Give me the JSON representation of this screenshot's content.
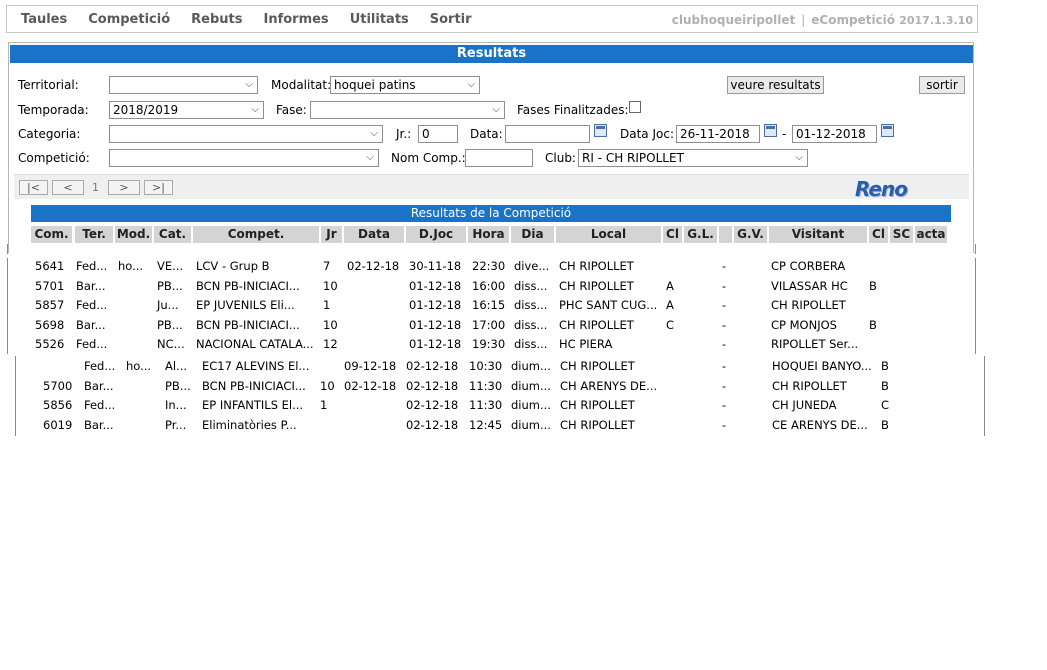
{
  "menu": [
    "Taules",
    "Competició",
    "Rebuts",
    "Informes",
    "Utilitats",
    "Sortir"
  ],
  "brand": {
    "club": "clubhoqueiripollet",
    "sep": "|",
    "app": "eCompetició",
    "version": "2017.1.3.10"
  },
  "panel_title": "Resultats",
  "form": {
    "territorial_label": "Territorial:",
    "territorial_value": "",
    "modalitat_label": "Modalitat:",
    "modalitat_value": "hoquei patins",
    "temporada_label": "Temporada:",
    "temporada_value": "2018/2019",
    "fase_label": "Fase:",
    "fase_value": "",
    "fases_final_label": "Fases Finalitzades:",
    "categoria_label": "Categoria:",
    "categoria_value": "",
    "jr_label": "Jr.:",
    "jr_value": "0",
    "data_label": "Data:",
    "data_value": "",
    "datajoc_label": "Data Joc:",
    "datajoc_from": "26-11-2018",
    "dash": "-",
    "datajoc_to": "01-12-2018",
    "competicio_label": "Competició:",
    "competicio_value": "",
    "nomcomp_label": "Nom Comp.:",
    "nomcomp_value": "",
    "club_label": "Club:",
    "club_value": "RI - CH RIPOLLET",
    "veure_label": "veure resultats",
    "sortir_label": "sortir"
  },
  "pager": {
    "first": "|<",
    "prev": "<",
    "page": "1",
    "next": ">",
    "last": ">|"
  },
  "logo": "Reno",
  "results_title": "Resultats de la Competició",
  "columns": [
    "Com.",
    "Ter.",
    "Mod.",
    "Cat.",
    "Compet.",
    "Jr",
    "Data",
    "D.Joc",
    "Hora",
    "Dia",
    "Local",
    "Cl",
    "G.L.",
    "",
    "G.V.",
    "Visitant",
    "Cl",
    "SC",
    "acta"
  ],
  "rows_a": [
    [
      "5641",
      "Fed...",
      "ho...",
      "VE...",
      "LCV - Grup B",
      "7",
      "02-12-18",
      "30-11-18",
      "22:30",
      "dive...",
      "CH RIPOLLET",
      "",
      "-",
      "CP CORBERA",
      ""
    ],
    [
      "5701",
      "Bar...",
      "",
      "PB...",
      "BCN PB-INICIACI...",
      "10",
      "",
      "01-12-18",
      "16:00",
      "diss...",
      "CH RIPOLLET",
      "A",
      "-",
      "VILASSAR HC",
      "B"
    ],
    [
      "5857",
      "Fed...",
      "",
      "Ju...",
      "EP JUVENILS Eli...",
      "1",
      "",
      "01-12-18",
      "16:15",
      "diss...",
      "PHC SANT CUG...",
      "A",
      "-",
      "CH RIPOLLET",
      ""
    ],
    [
      "5698",
      "Bar...",
      "",
      "PB...",
      "BCN PB-INICIACI...",
      "10",
      "",
      "01-12-18",
      "17:00",
      "diss...",
      "CH RIPOLLET",
      "C",
      "-",
      "CP MONJOS",
      "B"
    ],
    [
      "5526",
      "Fed...",
      "",
      "NC...",
      "NACIONAL CATALA...",
      "12",
      "",
      "01-12-18",
      "19:30",
      "diss...",
      "HC PIERA",
      "",
      "-",
      "RIPOLLET Ser...",
      ""
    ]
  ],
  "rows_b": [
    [
      "",
      "Fed...",
      "ho...",
      "Al...",
      "EC17 ALEVINS El...",
      "",
      "09-12-18",
      "02-12-18",
      "10:30",
      "dium...",
      "CH RIPOLLET",
      "",
      "-",
      "HOQUEI BANYO...",
      "B"
    ],
    [
      "5700",
      "Bar...",
      "",
      "PB...",
      "BCN PB-INICIACI...",
      "10",
      "02-12-18",
      "02-12-18",
      "11:30",
      "dium...",
      "CH ARENYS DE...",
      "",
      "-",
      "CH RIPOLLET",
      "B"
    ],
    [
      "5856",
      "Fed...",
      "",
      "In...",
      "EP INFANTILS El...",
      "1",
      "",
      "02-12-18",
      "11:30",
      "dium...",
      "CH RIPOLLET",
      "",
      "-",
      "CH JUNEDA",
      "C"
    ],
    [
      "6019",
      "Bar...",
      "",
      "Pr...",
      "Eliminatòries P...",
      "",
      "",
      "02-12-18",
      "12:45",
      "dium...",
      "CH RIPOLLET",
      "",
      "-",
      "CE ARENYS DE...",
      "B"
    ]
  ]
}
